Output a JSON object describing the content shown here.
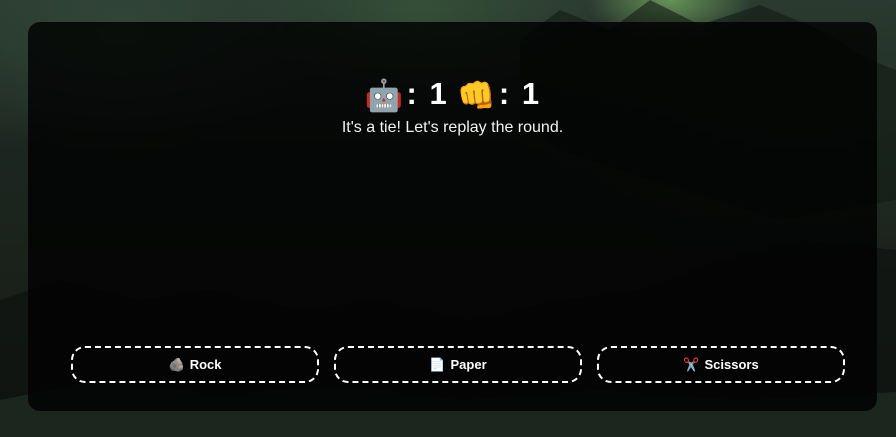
{
  "scoreboard": {
    "computer_icon": "🤖",
    "computer_score": "1",
    "player_icon": "👊",
    "player_score": "1",
    "separator": ":"
  },
  "status_message": "It's a tie! Let's replay the round.",
  "choices": [
    {
      "icon": "🪨",
      "icon_name": "rock-icon",
      "label": "Rock"
    },
    {
      "icon": "📄",
      "icon_name": "paper-icon",
      "label": "Paper"
    },
    {
      "icon": "✂️",
      "icon_name": "scissors-icon",
      "label": "Scissors"
    }
  ],
  "colors": {
    "panel": "#000000",
    "text": "#ffffff",
    "aurora_accent": "#96dc78"
  }
}
